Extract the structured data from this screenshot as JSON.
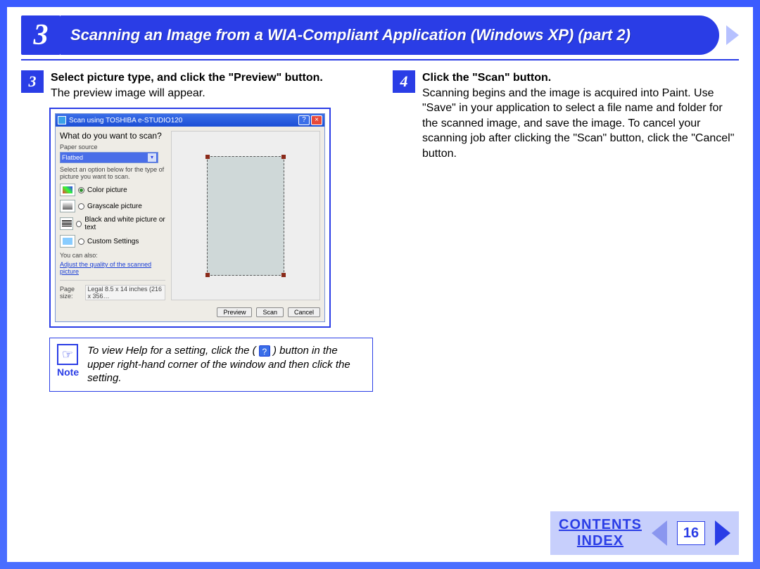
{
  "chapter": {
    "number": "3",
    "title": "Scanning an Image from a WIA-Compliant Application (Windows XP) (part 2)"
  },
  "left_step": {
    "number": "3",
    "title": "Select picture type, and click the \"Preview\" button.",
    "body": "The preview image will appear."
  },
  "right_step": {
    "number": "4",
    "title": "Click the \"Scan\" button.",
    "body": "Scanning begins and the image is acquired into Paint. Use \"Save\" in your application to select a file name and folder for the scanned image, and save the image. To cancel your scanning job after clicking the \"Scan\" button, click the \"Cancel\" button."
  },
  "dialog": {
    "title": "Scan using TOSHIBA e-STUDIO120",
    "heading": "What do you want to scan?",
    "paper_source_label": "Paper source",
    "paper_source_value": "Flatbed",
    "select_option_text": "Select an option below for the type of picture you want to scan.",
    "options": {
      "color": "Color picture",
      "gray": "Grayscale picture",
      "bw": "Black and white picture or text",
      "custom": "Custom Settings"
    },
    "you_can_also": "You can also:",
    "adjust_link": "Adjust the quality of the scanned picture",
    "page_size_label": "Page size:",
    "page_size_value": "Legal 8.5 x 14 inches (216 x 356…",
    "buttons": {
      "preview": "Preview",
      "scan": "Scan",
      "cancel": "Cancel"
    }
  },
  "note": {
    "label": "Note",
    "text_before": "To view Help for a setting, click the (",
    "text_after": ") button in the upper right-hand corner of the window and then click the setting."
  },
  "footer": {
    "contents": "CONTENTS",
    "index": "INDEX",
    "page": "16"
  }
}
